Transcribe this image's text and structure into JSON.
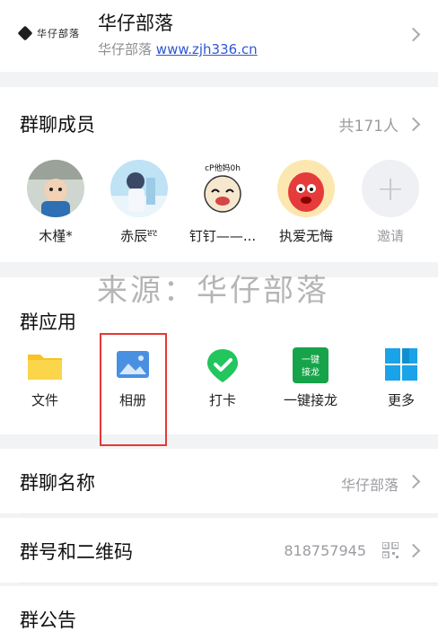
{
  "header": {
    "logo_text": "华仔部落",
    "title": "华仔部落",
    "subtitle_prefix": "华仔部落",
    "subtitle_link": "www.zjh336.cn"
  },
  "members": {
    "title": "群聊成员",
    "count": "共171人",
    "list": [
      {
        "name": "木槿*"
      },
      {
        "name": "赤辰ᵉ̈ᶜ̈"
      },
      {
        "name": "钉钉——..."
      },
      {
        "name": "执爱无悔"
      }
    ],
    "invite_label": "邀请",
    "sticker_text": "cP他妈0h"
  },
  "apps": {
    "title": "群应用",
    "items": [
      {
        "label": "文件",
        "icon": "folder-icon"
      },
      {
        "label": "相册",
        "icon": "photo-album-icon"
      },
      {
        "label": "打卡",
        "icon": "check-in-icon"
      },
      {
        "label": "一键接龙",
        "icon": "solitaire-icon",
        "icon_text": "一键\n接龙"
      },
      {
        "label": "更多",
        "icon": "grid-more-icon"
      }
    ]
  },
  "watermark": "来源：华仔部落",
  "settings": {
    "group_name_label": "群聊名称",
    "group_name_value": "华仔部落",
    "group_id_label": "群号和二维码",
    "group_id_value": "818757945",
    "notice_label": "群公告"
  },
  "colors": {
    "accent_link": "#2f57d6",
    "highlight_border": "#e53935",
    "folder": "#f7c325",
    "album": "#4a90e2",
    "checkin": "#22c55e",
    "solitaire": "#17a34a",
    "more": "#1aa3e8"
  }
}
